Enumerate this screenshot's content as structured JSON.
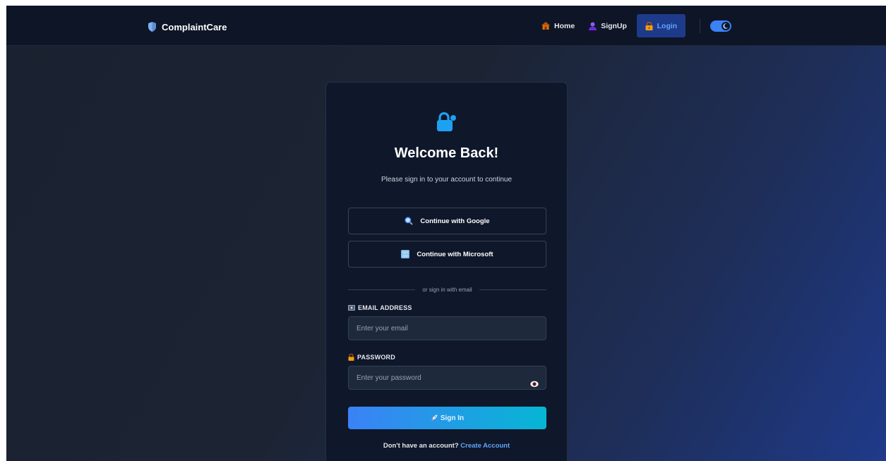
{
  "nav": {
    "brand": "ComplaintCare",
    "links": [
      {
        "label": "Home",
        "icon": "house-icon"
      },
      {
        "label": "SignUp",
        "icon": "user-icon"
      },
      {
        "label": "Login",
        "icon": "lock-icon",
        "active": true
      }
    ],
    "theme_toggle_icon": "moon-icon"
  },
  "login": {
    "title": "Welcome Back!",
    "subtitle": "Please sign in to your account to continue",
    "google_label": "Continue with Google",
    "microsoft_label": "Continue with Microsoft",
    "divider_text": "or sign in with email",
    "email_label": "EMAIL ADDRESS",
    "email_placeholder": "Enter your email",
    "email_value": "",
    "password_label": "PASSWORD",
    "password_placeholder": "Enter your password",
    "password_value": "",
    "submit_label": "Sign In",
    "signup_prompt": "Don't have an account?",
    "signup_link": "Create Account"
  },
  "colors": {
    "accent": "#3b82f6",
    "accent_end": "#06b6d4",
    "link": "#60a5fa",
    "card_bg": "#0f172a",
    "nav_bg": "#0d1526"
  }
}
